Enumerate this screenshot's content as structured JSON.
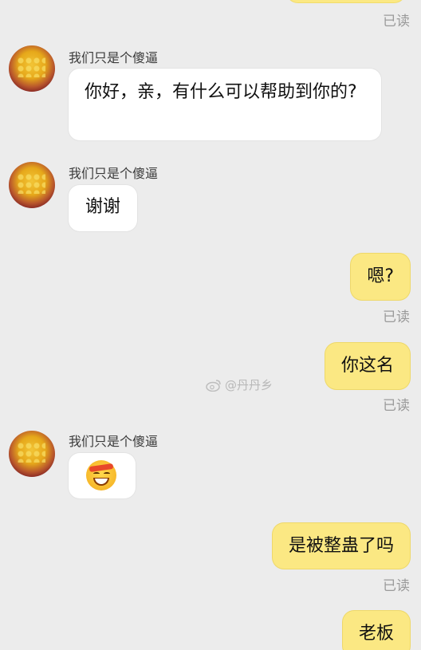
{
  "conversation": {
    "contact_name": "我们只是个傻逼",
    "read_status": "已读",
    "watermark": "@丹丹乡",
    "messages": [
      {
        "side": "left",
        "name": "我们只是个傻逼",
        "text": "你好，亲，有什么可以帮助到你的?"
      },
      {
        "side": "left",
        "name": "我们只是个傻逼",
        "text": "谢谢"
      },
      {
        "side": "right",
        "text": "嗯?",
        "status": "已读"
      },
      {
        "side": "right",
        "text": "你这名",
        "status": "已读"
      },
      {
        "side": "left",
        "name": "我们只是个傻逼",
        "emoji": "grinning-headband-emoji"
      },
      {
        "side": "right",
        "text": "是被整蛊了吗",
        "status": "已读"
      },
      {
        "side": "right",
        "text": "老板"
      }
    ]
  },
  "colors": {
    "background": "#ececec",
    "outgoing_bubble": "#fbe883",
    "incoming_bubble": "#ffffff",
    "read_text": "#9a9a9a"
  },
  "icons": {
    "avatar": "passion-fruit-avatar",
    "watermark_icon": "weibo-icon"
  }
}
